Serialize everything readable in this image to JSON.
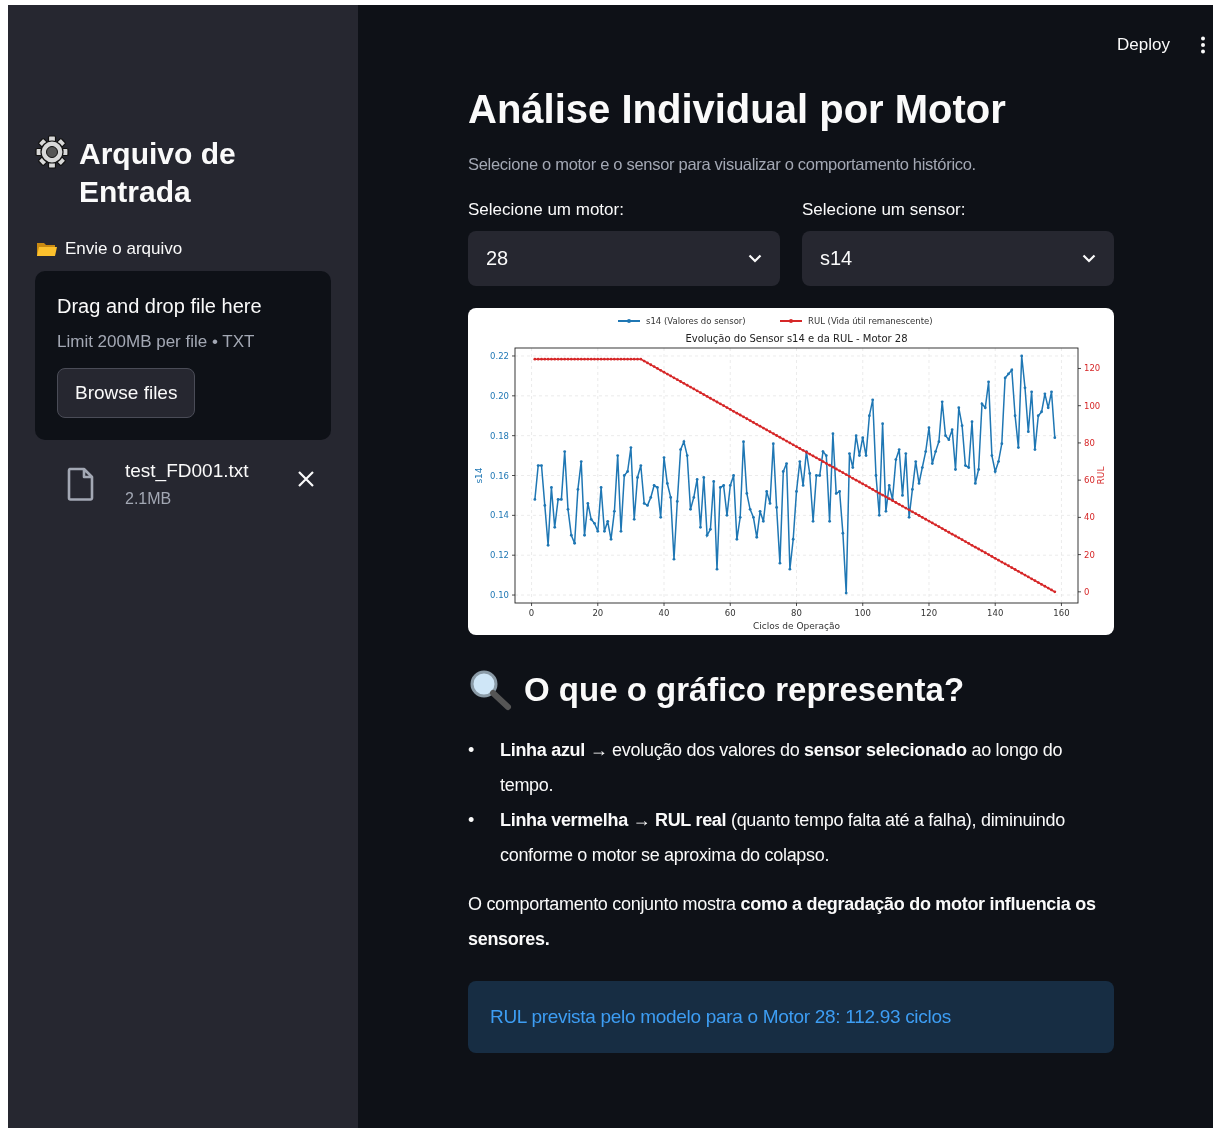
{
  "header": {
    "deploy": "Deploy"
  },
  "sidebar": {
    "title": "Arquivo de Entrada",
    "uploader": {
      "label": "Envie o arquivo",
      "dropzone_title": "Drag and drop file here",
      "limit": "Limit 200MB per file • TXT",
      "button": "Browse files"
    },
    "files": [
      {
        "name": "test_FD001.txt",
        "size": "2.1MB"
      }
    ]
  },
  "main": {
    "title": "Análise Individual por Motor",
    "subtitle": "Selecione o motor e o sensor para visualizar o comportamento histórico.",
    "selects": [
      {
        "label": "Selecione um motor:",
        "value": "28"
      },
      {
        "label": "Selecione um sensor:",
        "value": "s14"
      }
    ],
    "chart_data": {
      "type": "line",
      "title": "Evolução do Sensor s14 e da RUL - Motor 28",
      "xlabel": "Ciclos de Operação",
      "ylabel": "s14",
      "y2label": "RUL",
      "grid": true,
      "legend": "top",
      "xlim": [
        -5,
        165
      ],
      "ylim": [
        0.096,
        0.224
      ],
      "y2lim": [
        -6,
        131
      ],
      "xticks": [
        0,
        20,
        40,
        60,
        80,
        100,
        120,
        140,
        160
      ],
      "yticks": [
        {
          "value": 0.1,
          "label": "0.10"
        },
        {
          "value": 0.12,
          "label": "0.12"
        },
        {
          "value": 0.14,
          "label": "0.14"
        },
        {
          "value": 0.16,
          "label": "0.16"
        },
        {
          "value": 0.18,
          "label": "0.18"
        },
        {
          "value": 0.2,
          "label": "0.20"
        },
        {
          "value": 0.22,
          "label": "0.22"
        }
      ],
      "y2ticks": [
        0,
        20,
        40,
        60,
        80,
        100,
        120
      ],
      "x": [
        1,
        2,
        3,
        4,
        5,
        6,
        7,
        8,
        9,
        10,
        11,
        12,
        13,
        14,
        15,
        16,
        17,
        18,
        19,
        20,
        21,
        22,
        23,
        24,
        25,
        26,
        27,
        28,
        29,
        30,
        31,
        32,
        33,
        34,
        35,
        36,
        37,
        38,
        39,
        40,
        41,
        42,
        43,
        44,
        45,
        46,
        47,
        48,
        49,
        50,
        51,
        52,
        53,
        54,
        55,
        56,
        57,
        58,
        59,
        60,
        61,
        62,
        63,
        64,
        65,
        66,
        67,
        68,
        69,
        70,
        71,
        72,
        73,
        74,
        75,
        76,
        77,
        78,
        79,
        80,
        81,
        82,
        83,
        84,
        85,
        86,
        87,
        88,
        89,
        90,
        91,
        92,
        93,
        94,
        95,
        96,
        97,
        98,
        99,
        100,
        101,
        102,
        103,
        104,
        105,
        106,
        107,
        108,
        109,
        110,
        111,
        112,
        113,
        114,
        115,
        116,
        117,
        118,
        119,
        120,
        121,
        122,
        123,
        124,
        125,
        126,
        127,
        128,
        129,
        130,
        131,
        132,
        133,
        134,
        135,
        136,
        137,
        138,
        139,
        140,
        141,
        142,
        143,
        144,
        145,
        146,
        147,
        148,
        149,
        150,
        151,
        152,
        153,
        154,
        155,
        156,
        157,
        158
      ],
      "series": [
        {
          "name": "s14 (Valores do sensor)",
          "color": "#1f77b4",
          "values": [
            0.148,
            0.165,
            0.165,
            0.145,
            0.125,
            0.154,
            0.134,
            0.148,
            0.148,
            0.172,
            0.143,
            0.13,
            0.126,
            0.153,
            0.167,
            0.13,
            0.146,
            0.138,
            0.136,
            0.132,
            0.154,
            0.132,
            0.137,
            0.128,
            0.142,
            0.17,
            0.132,
            0.16,
            0.162,
            0.174,
            0.138,
            0.159,
            0.165,
            0.146,
            0.145,
            0.149,
            0.155,
            0.154,
            0.139,
            0.169,
            0.156,
            0.149,
            0.118,
            0.147,
            0.173,
            0.177,
            0.17,
            0.143,
            0.149,
            0.158,
            0.134,
            0.159,
            0.13,
            0.133,
            0.157,
            0.113,
            0.154,
            0.155,
            0.14,
            0.155,
            0.16,
            0.128,
            0.139,
            0.177,
            0.151,
            0.143,
            0.139,
            0.129,
            0.142,
            0.137,
            0.152,
            0.146,
            0.176,
            0.144,
            0.116,
            0.162,
            0.166,
            0.113,
            0.128,
            0.152,
            0.167,
            0.155,
            0.172,
            0.161,
            0.137,
            0.16,
            0.16,
            0.172,
            0.17,
            0.137,
            0.181,
            0.151,
            0.152,
            0.131,
            0.101,
            0.171,
            0.164,
            0.18,
            0.17,
            0.179,
            0.17,
            0.19,
            0.198,
            0.16,
            0.14,
            0.186,
            0.142,
            0.155,
            0.148,
            0.168,
            0.173,
            0.15,
            0.171,
            0.139,
            0.153,
            0.167,
            0.156,
            0.164,
            0.172,
            0.184,
            0.166,
            0.172,
            0.177,
            0.197,
            0.18,
            0.178,
            0.183,
            0.163,
            0.194,
            0.185,
            0.165,
            0.164,
            0.187,
            0.156,
            0.163,
            0.196,
            0.194,
            0.207,
            0.17,
            0.162,
            0.167,
            0.176,
            0.209,
            0.211,
            0.213,
            0.19,
            0.174,
            0.22,
            0.204,
            0.182,
            0.202,
            0.173,
            0.19,
            0.192,
            0.201,
            0.194,
            0.202,
            0.179
          ]
        },
        {
          "name": "RUL (Vida útil remanescente)",
          "color": "#d62728",
          "axis": "y2",
          "values": [
            125,
            125,
            125,
            125,
            125,
            125,
            125,
            125,
            125,
            125,
            125,
            125,
            125,
            125,
            125,
            125,
            125,
            125,
            125,
            125,
            125,
            125,
            125,
            125,
            125,
            125,
            125,
            125,
            125,
            125,
            125,
            125,
            125,
            124,
            123,
            122,
            121,
            120,
            119,
            118,
            117,
            116,
            115,
            114,
            113,
            112,
            111,
            110,
            109,
            108,
            107,
            106,
            105,
            104,
            103,
            102,
            101,
            100,
            99,
            98,
            97,
            96,
            95,
            94,
            93,
            92,
            91,
            90,
            89,
            88,
            87,
            86,
            85,
            84,
            83,
            82,
            81,
            80,
            79,
            78,
            77,
            76,
            75,
            74,
            73,
            72,
            71,
            70,
            69,
            68,
            67,
            66,
            65,
            64,
            63,
            62,
            61,
            60,
            59,
            58,
            57,
            56,
            55,
            54,
            53,
            52,
            51,
            50,
            49,
            48,
            47,
            46,
            45,
            44,
            43,
            42,
            41,
            40,
            39,
            38,
            37,
            36,
            35,
            34,
            33,
            32,
            31,
            30,
            29,
            28,
            27,
            26,
            25,
            24,
            23,
            22,
            21,
            20,
            19,
            18,
            17,
            16,
            15,
            14,
            13,
            12,
            11,
            10,
            9,
            8,
            7,
            6,
            5,
            4,
            3,
            2,
            1,
            0
          ]
        }
      ]
    },
    "section_title": "O que o gráfico representa?",
    "bullets": [
      {
        "marker": "•",
        "text": "**Linha azul** → evolução dos valores do **sensor selecionado** ao longo do tempo."
      },
      {
        "marker": "•",
        "text": "**Linha vermelha** → **RUL real** (quanto tempo falta até a falha), diminuindo conforme o motor se aproxima do colapso."
      }
    ],
    "paragraph": "O comportamento conjunto mostra **como a degradação do motor influencia os sensores.**",
    "info": "RUL prevista pelo modelo para o Motor 28: 112.93 ciclos"
  }
}
